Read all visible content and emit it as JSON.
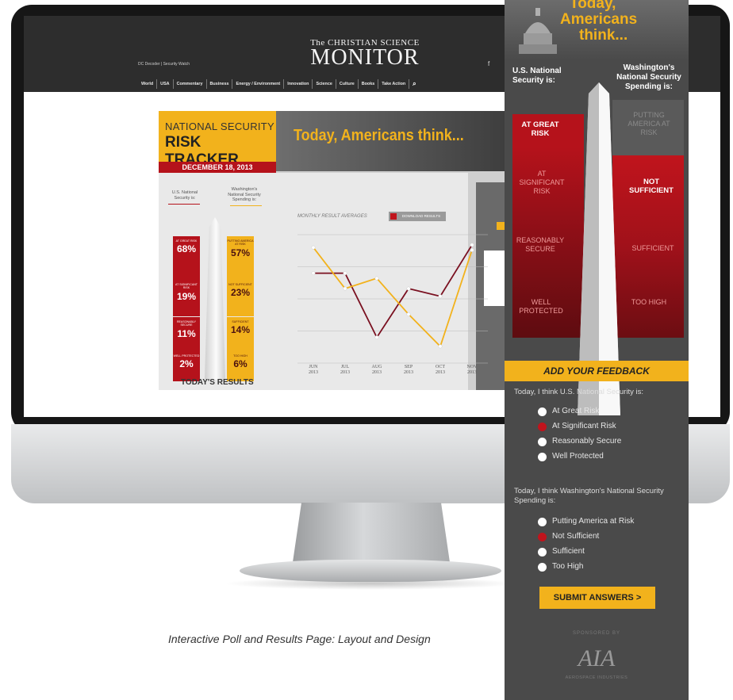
{
  "site": {
    "logo_small": "The CHRISTIAN SCIENCE",
    "logo_main": "MONITOR",
    "top_links": "DC Decoder  |  Security Watch",
    "social_icon": "f",
    "nav": [
      "World",
      "USA",
      "Commentary",
      "Business",
      "Energy / Environment",
      "Innovation",
      "Science",
      "Culture",
      "Books",
      "Take Action"
    ],
    "search_icon": "search-icon"
  },
  "widget": {
    "title_line1": "NATIONAL SECURITY",
    "title_line2": "RISK TRACKER",
    "date": "DECEMBER 18, 2013",
    "headline": "Today, Americans think...",
    "col_left": "U.S. National Security is:",
    "col_right": "Washington's National Security Spending is:",
    "left_results": [
      {
        "label": "AT GREAT RISK",
        "pct": "68%"
      },
      {
        "label": "AT SIGNIFICANT RISK",
        "pct": "19%"
      },
      {
        "label": "REASONABLY SECURE",
        "pct": "11%"
      },
      {
        "label": "WELL PROTECTED",
        "pct": "2%"
      }
    ],
    "right_results": [
      {
        "label": "PUTTING AMERICA AT RISK",
        "pct": "57%"
      },
      {
        "label": "NOT SUFFICIENT",
        "pct": "23%"
      },
      {
        "label": "SUFFICIENT",
        "pct": "14%"
      },
      {
        "label": "TOO HIGH",
        "pct": "6%"
      }
    ],
    "todays_results": "TODAY'S RESULTS",
    "chart_title": "MONTHLY RESULT AVERAGES",
    "download_label": "DOWNLOAD RESULTS"
  },
  "chart_data": {
    "type": "line",
    "title": "MONTHLY RESULT AVERAGES",
    "x": [
      "JUN 2013",
      "JUL 2013",
      "AUG 2013",
      "SEP 2013",
      "OCT 2013",
      "NOV 2013"
    ],
    "ylim": [
      0,
      100
    ],
    "grid": true,
    "series": [
      {
        "color": "#7a1020",
        "values": [
          70,
          70,
          20,
          58,
          52,
          92
        ]
      },
      {
        "color": "#f2b21c",
        "values": [
          90,
          58,
          66,
          38,
          13,
          88
        ]
      }
    ]
  },
  "sidebar": {
    "title": [
      "Today,",
      "Americans",
      "think..."
    ],
    "hdr_left": "U.S. National Security is:",
    "hdr_right": "Washington's National Security Spending is:",
    "left_bands": [
      "AT GREAT RISK",
      "AT SIGNIFICANT RISK",
      "REASONABLY SECURE",
      "WELL PROTECTED"
    ],
    "right_bands": [
      "PUTTING AMERICA AT RISK",
      "NOT SUFFICIENT",
      "SUFFICIENT",
      "TOO HIGH"
    ],
    "feedback_title": "ADD YOUR FEEDBACK",
    "q1": "Today, I think U.S. National Security is:",
    "q1_options": [
      "At Great Risk",
      "At Significant Risk",
      "Reasonably Secure",
      "Well Protected"
    ],
    "q1_selected": 1,
    "q2": "Today, I think Washington's National Security Spending is:",
    "q2_options": [
      "Putting America at Risk",
      "Not Sufficient",
      "Sufficient",
      "Too High"
    ],
    "q2_selected": 1,
    "submit": "SUBMIT ANSWERS >",
    "sponsored": "SPONSORED BY",
    "sponsor_logo": "AIA",
    "sponsor_sub": "AEROSPACE INDUSTRIES",
    "colors": {
      "accent": "#f2b21c",
      "red": "#b5121b",
      "dark": "#4a4a4a"
    }
  },
  "caption": "Interactive Poll and Results Page: Layout and Design"
}
